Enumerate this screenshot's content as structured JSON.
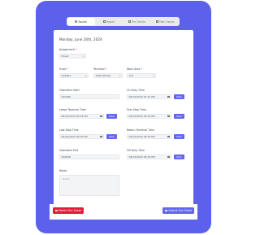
{
  "tabs": [
    {
      "label": "Routes",
      "icon": "clock-icon",
      "active": true
    },
    {
      "label": "Repair",
      "icon": "dollar-icon",
      "active": false
    },
    {
      "label": "Pre Checks",
      "icon": "checklist-icon",
      "active": false
    },
    {
      "label": "Post Checks",
      "icon": "checklist-icon",
      "active": false
    }
  ],
  "date_title": "Monday, June 24th, 2024",
  "form": {
    "assignment": {
      "label": "Assignment",
      "value": "Driver"
    },
    "truck": {
      "label": "Truck",
      "value": "DLR801"
    },
    "terminal": {
      "label": "Terminal",
      "value": "1580 (EGYA)"
    },
    "work_area": {
      "label": "Work Area",
      "value": "103"
    },
    "odometer_start": {
      "label": "Odometer Start",
      "value": "200486"
    },
    "on_duty_time": {
      "label": "On Duty Time",
      "value": "06/24/2024 07:41 PM"
    },
    "leave_terminal_time": {
      "label": "Leave Terminal Time",
      "value": "06/24/2024 05:44 PM"
    },
    "first_stop_time": {
      "label": "First Stop Time",
      "value": "06/24/2024 06:00 PM"
    },
    "last_stop_time": {
      "label": "Last Stop Time",
      "value": "06/24/2024 06:00 PM"
    },
    "return_terminal_time": {
      "label": "Return Terminal Time",
      "value": "06/24/2024 06:00 PM"
    },
    "odometer_end": {
      "label": "Odometer End",
      "value": "200658"
    },
    "off_duty_time": {
      "label": "Off Duty Time",
      "value": "06/24/2024 06:00 PM"
    },
    "notes": {
      "label": "Notes",
      "placeholder": "Notes"
    },
    "required_mark": "*",
    "now_label": "Now"
  },
  "footer": {
    "delete_label": "Delete Run Sheet",
    "submit_label": "Submit Run Sheet"
  },
  "colors": {
    "device": "#5b61ea",
    "primary_button": "#6366f1",
    "danger_button": "#e11d3b"
  }
}
